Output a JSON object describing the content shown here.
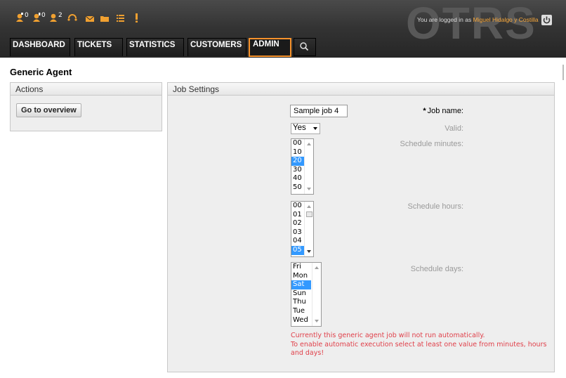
{
  "header": {
    "watermark": "OTRS",
    "login_prefix": "You are logged in as ",
    "login_user": "Miguel Hidalgo y Costilla",
    "toolbar": [
      {
        "icon": "agent-new-icon",
        "count": "0"
      },
      {
        "icon": "agent-watch-icon",
        "count": "0"
      },
      {
        "icon": "agent-locked-icon",
        "count": "2"
      },
      {
        "icon": "phone-ticket-icon",
        "count": ""
      },
      {
        "icon": "email-ticket-icon",
        "count": ""
      },
      {
        "icon": "folder-icon",
        "count": ""
      },
      {
        "icon": "list-icon",
        "count": ""
      },
      {
        "icon": "alert-icon",
        "count": ""
      }
    ]
  },
  "nav": {
    "dashboard": "DASHBOARD",
    "tickets": "TICKETS",
    "statistics": "STATISTICS",
    "customers": "CUSTOMERS",
    "admin": "ADMIN"
  },
  "page": {
    "title": "Generic Agent"
  },
  "actions": {
    "header": "Actions",
    "go_overview": "Go to overview"
  },
  "job": {
    "header": "Job Settings",
    "job_name_label": "Job name:",
    "job_name_value": "Sample job 4",
    "valid_label": "Valid:",
    "valid_value": "Yes",
    "minutes_label": "Schedule minutes:",
    "minutes_options": [
      "00",
      "10",
      "20",
      "30",
      "40",
      "50"
    ],
    "hours_label": "Schedule hours:",
    "hours_options": [
      "00",
      "01",
      "02",
      "03",
      "04",
      "05"
    ],
    "days_label": "Schedule days:",
    "days_options": [
      "Fri",
      "Mon",
      "Sat",
      "Sun",
      "Thu",
      "Tue",
      "Wed"
    ],
    "warning_line1": "Currently this generic agent job will not run automatically.",
    "warning_line2": "To enable automatic execution select at least one value from minutes, hours and days!"
  },
  "colors": {
    "accent": "#f7922b",
    "selection": "#3399ff",
    "warning": "#e0404a"
  }
}
